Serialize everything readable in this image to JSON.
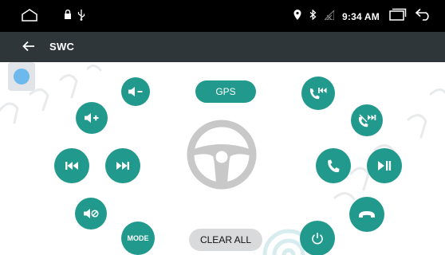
{
  "status_bar": {
    "time": "9:34 AM",
    "icons": [
      "home-outline-icon",
      "lock-icon",
      "usb-icon",
      "location-icon",
      "bluetooth-icon",
      "no-signal-icon",
      "recents-icon",
      "back-arrow-icon"
    ]
  },
  "header": {
    "title": "SWC",
    "back_icon": "back-arrow-icon"
  },
  "buttons": {
    "gps_label": "GPS",
    "clear_all_label": "CLEAR ALL",
    "mode_label": "MODE"
  },
  "swc_icons": [
    "volume-down-icon",
    "volume-up-icon",
    "previous-track-icon",
    "next-track-icon",
    "mute-icon",
    "mode-icon",
    "call-previous-icon",
    "call-next-icon",
    "answer-call-icon",
    "play-pause-icon",
    "hang-up-icon",
    "power-icon",
    "steering-wheel-icon"
  ],
  "colors": {
    "accent": "#21998c",
    "status_bar": "#000000",
    "title_bar": "#2e363a",
    "pill_gray": "#d8dadc",
    "touch_indicator": "#6db9ee"
  }
}
